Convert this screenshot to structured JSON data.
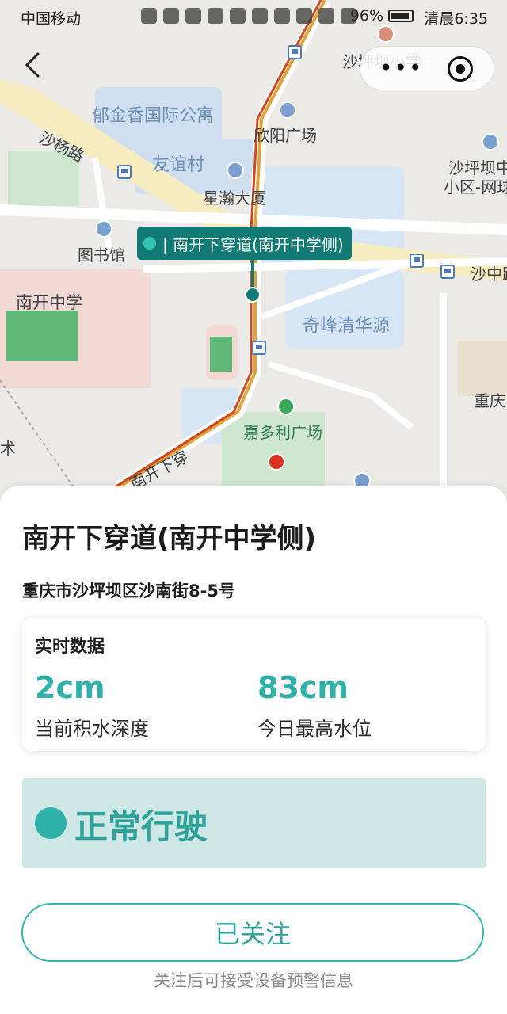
{
  "status_bar": {
    "carrier": "中国移动",
    "battery": "96%",
    "time": "清晨6:35"
  },
  "map": {
    "labels": {
      "shapingba_primary": "沙坪坝小学",
      "yujinxiang": "郁金香国际公寓",
      "xinyang": "欣阳广场",
      "shayang_road": "沙杨路",
      "youyi": "友谊村",
      "xinghan": "星瀚大厦",
      "shapingba_right": "沙坪坝中",
      "xiaoqu": "小区-网球",
      "library": "图书馆",
      "shazhong": "沙中路",
      "nankai_school": "南开中学",
      "qifeng": "奇峰清华源",
      "chongqing": "重庆",
      "jiaduoli": "嘉多利广场",
      "nankai_road": "南开下穿",
      "shu": "术"
    },
    "marker_label": "| 南开下穿道(南开中学侧)"
  },
  "sheet": {
    "title": "南开下穿道(南开中学侧)",
    "address": "重庆市沙坪坝区沙南街8-5号",
    "realtime": {
      "title": "实时数据",
      "current_depth_value": "2cm",
      "current_depth_label": "当前积水深度",
      "max_level_value": "83cm",
      "max_level_label": "今日最高水位"
    },
    "status_text": "正常行驶",
    "follow_button": "已关注",
    "hint": "关注后可接受设备预警信息"
  },
  "colors": {
    "accent": "#2fb0a8",
    "marker": "#127a74",
    "status_bg": "#cfe8e6"
  }
}
